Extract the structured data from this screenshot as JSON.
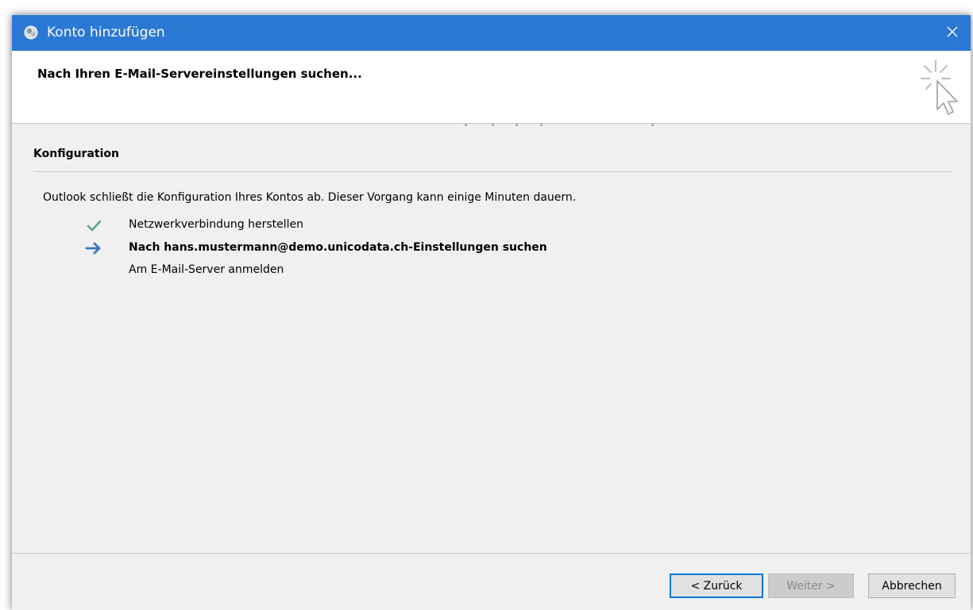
{
  "window": {
    "title": "Konto hinzufügen"
  },
  "header": {
    "title": "Nach Ihren E-Mail-Servereinstellungen suchen..."
  },
  "section": {
    "heading": "Konfiguration",
    "description": "Outlook schließt die Konfiguration Ihres Kontos ab. Dieser Vorgang kann einige Minuten dauern."
  },
  "steps": [
    {
      "label": "Netzwerkverbindung herstellen",
      "status": "done",
      "icon": "check-icon"
    },
    {
      "label": "Nach hans.mustermann@demo.unicodata.ch-Einstellungen suchen",
      "status": "active",
      "icon": "arrow-right-icon"
    },
    {
      "label": "Am E-Mail-Server anmelden",
      "status": "pending",
      "icon": ""
    }
  ],
  "buttons": {
    "back_label": "< Zurück",
    "next_label": "Weiter >",
    "cancel_label": "Abbrechen"
  },
  "colors": {
    "titlebar": "#2b78d4",
    "check": "#5aa58a",
    "arrow": "#3b78c0",
    "focus_border": "#0078d7"
  }
}
